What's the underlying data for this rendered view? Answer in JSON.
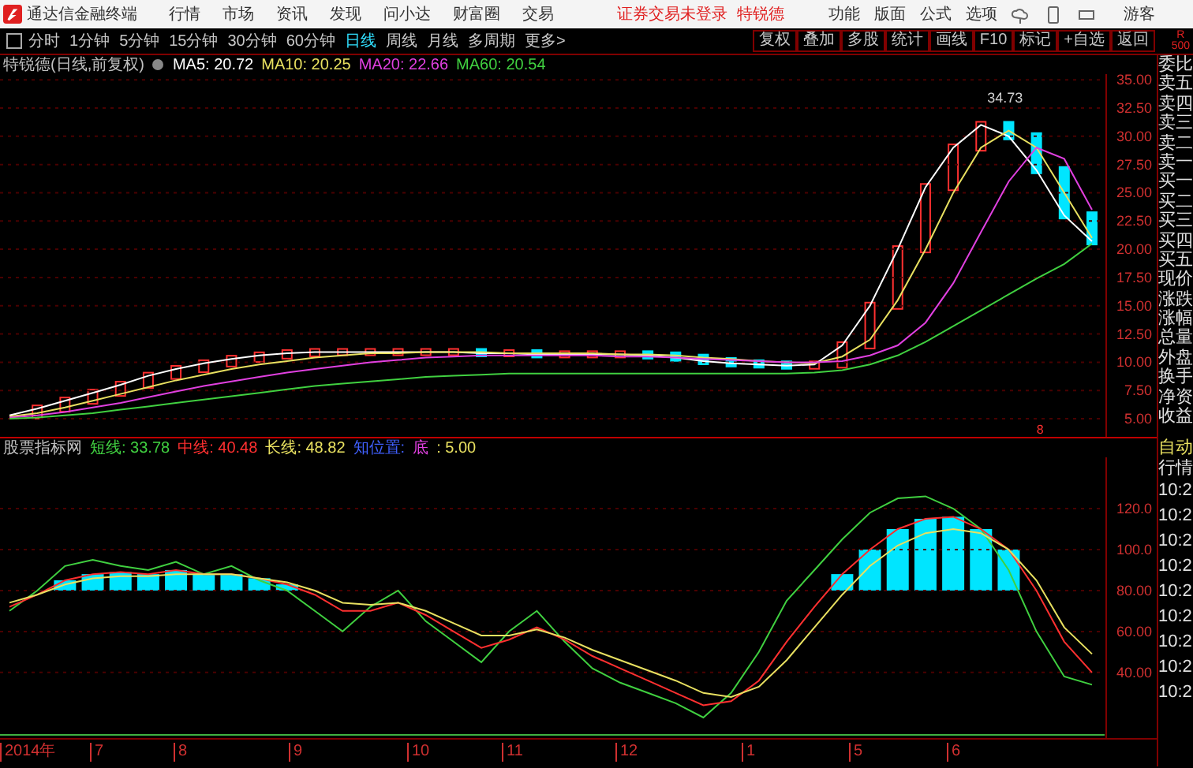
{
  "title_bar": {
    "app_name": "通达信金融终端",
    "menu": [
      "行情",
      "市场",
      "资讯",
      "发现",
      "问小达",
      "财富圈",
      "交易"
    ],
    "login_notice": "证券交易未登录",
    "stock_name": "特锐德",
    "tools": [
      "功能",
      "版面",
      "公式",
      "选项"
    ],
    "user": "游客"
  },
  "toolbar": {
    "periods": [
      {
        "label": "分时",
        "selected": false
      },
      {
        "label": "1分钟",
        "selected": false
      },
      {
        "label": "5分钟",
        "selected": false
      },
      {
        "label": "15分钟",
        "selected": false
      },
      {
        "label": "30分钟",
        "selected": false
      },
      {
        "label": "60分钟",
        "selected": false
      },
      {
        "label": "日线",
        "selected": true
      },
      {
        "label": "周线",
        "selected": false
      },
      {
        "label": "月线",
        "selected": false
      },
      {
        "label": "多周期",
        "selected": false
      },
      {
        "label": "更多>",
        "selected": false
      }
    ],
    "actions": [
      "复权",
      "叠加",
      "多股",
      "统计",
      "画线",
      "F10",
      "标记",
      "+自选",
      "返回"
    ],
    "corner": [
      "R",
      "500"
    ]
  },
  "main_chart": {
    "title": "特锐德(日线,前复权)",
    "legend_values": [
      ": 20.72",
      ": 20.25",
      ": 22.66",
      ": 20.54"
    ],
    "chart_data": {
      "type": "line",
      "grid": true,
      "ylim": [
        3.4,
        35.5
      ],
      "yticks": [
        {
          "value": 5,
          "label": "5.00"
        },
        {
          "value": 7.5,
          "label": "7.50"
        },
        {
          "value": 10,
          "label": "10.00"
        },
        {
          "value": 12.5,
          "label": "12.50"
        },
        {
          "value": 15,
          "label": "15.00"
        },
        {
          "value": 17.5,
          "label": "17.50"
        },
        {
          "value": 20,
          "label": "20.00"
        },
        {
          "value": 22.5,
          "label": "22.50"
        },
        {
          "value": 25,
          "label": "25.00"
        },
        {
          "value": 27.5,
          "label": "27.50"
        },
        {
          "value": 30,
          "label": "30.00"
        },
        {
          "value": 32.5,
          "label": "32.50"
        },
        {
          "value": 35,
          "label": "35.00"
        }
      ],
      "series": [
        {
          "name": "MA5",
          "color": "#ffffff",
          "values": [
            5.3,
            5.9,
            6.6,
            7.3,
            8.0,
            8.8,
            9.4,
            9.9,
            10.3,
            10.6,
            10.8,
            10.9,
            10.9,
            10.9,
            10.9,
            10.9,
            10.9,
            10.8,
            10.8,
            10.7,
            10.7,
            10.7,
            10.7,
            10.6,
            10.4,
            10.1,
            9.9,
            9.8,
            9.7,
            9.8,
            11.5,
            15,
            20,
            25.5,
            29,
            31,
            30,
            27,
            23,
            20.7
          ]
        },
        {
          "name": "MA10",
          "color": "#e8e060",
          "values": [
            5.2,
            5.5,
            6.0,
            6.6,
            7.2,
            7.8,
            8.4,
            8.9,
            9.4,
            9.8,
            10.1,
            10.4,
            10.6,
            10.8,
            10.8,
            10.9,
            10.9,
            10.9,
            10.8,
            10.8,
            10.8,
            10.8,
            10.7,
            10.7,
            10.6,
            10.4,
            10.3,
            10.1,
            10.0,
            9.9,
            10.5,
            12,
            15.5,
            20,
            25,
            29,
            30.5,
            29,
            25,
            21
          ]
        },
        {
          "name": "MA20",
          "color": "#e040e0",
          "values": [
            5.1,
            5.3,
            5.6,
            6.0,
            6.4,
            6.9,
            7.4,
            7.9,
            8.3,
            8.7,
            9.1,
            9.4,
            9.7,
            10.0,
            10.2,
            10.4,
            10.5,
            10.6,
            10.6,
            10.6,
            10.6,
            10.6,
            10.5,
            10.5,
            10.4,
            10.3,
            10.2,
            10.1,
            10.0,
            10.0,
            10.1,
            10.6,
            11.5,
            13.5,
            17,
            21.5,
            26,
            29,
            28,
            23.5
          ]
        },
        {
          "name": "MA60",
          "color": "#40d040",
          "values": [
            5.0,
            5.1,
            5.3,
            5.5,
            5.8,
            6.1,
            6.4,
            6.7,
            7.0,
            7.3,
            7.6,
            7.9,
            8.1,
            8.3,
            8.5,
            8.7,
            8.8,
            8.9,
            9.0,
            9.0,
            9.0,
            9.0,
            9.0,
            9.0,
            9.0,
            9.0,
            9.0,
            9.0,
            9.0,
            9.1,
            9.3,
            9.8,
            10.6,
            11.8,
            13.2,
            14.6,
            16,
            17.4,
            18.7,
            20.5
          ]
        }
      ],
      "annotations": [
        "34.73",
        "8"
      ]
    }
  },
  "indicator": {
    "title": "股票指标网",
    "legend_values": [
      ": 33.78",
      ": 40.48",
      ": 48.82"
    ],
    "extras": [
      {
        "label": "知位置:",
        "color": "#4060ff"
      },
      {
        "label": "底",
        "color": "#e040e0"
      },
      {
        "label": ": 5.00",
        "color": "#e8e060"
      }
    ],
    "chart_data": {
      "type": "line",
      "grid": true,
      "ylim": [
        8,
        145
      ],
      "yticks": [
        {
          "value": 40,
          "label": "40.00"
        },
        {
          "value": 60,
          "label": "60.00"
        },
        {
          "value": 80,
          "label": "80.00"
        },
        {
          "value": 100,
          "label": "100.0"
        },
        {
          "value": 120,
          "label": "120.0"
        }
      ],
      "series": [
        {
          "name": "短线",
          "color": "#40d040",
          "values": [
            70,
            80,
            92,
            95,
            92,
            90,
            94,
            88,
            92,
            85,
            80,
            70,
            60,
            72,
            80,
            65,
            55,
            45,
            60,
            70,
            55,
            42,
            35,
            30,
            25,
            18,
            30,
            50,
            75,
            90,
            105,
            118,
            125,
            126,
            120,
            110,
            90,
            60,
            38,
            34
          ]
        },
        {
          "name": "中线",
          "color": "#ff3030",
          "values": [
            72,
            78,
            85,
            88,
            89,
            88,
            90,
            88,
            88,
            86,
            83,
            78,
            70,
            70,
            74,
            68,
            60,
            52,
            56,
            62,
            56,
            48,
            42,
            36,
            30,
            24,
            26,
            36,
            55,
            72,
            88,
            100,
            110,
            115,
            116,
            110,
            100,
            80,
            55,
            40
          ]
        },
        {
          "name": "长线",
          "color": "#e8e060",
          "values": [
            74,
            78,
            83,
            86,
            87,
            87,
            88,
            88,
            88,
            86,
            84,
            80,
            74,
            73,
            74,
            70,
            64,
            58,
            58,
            61,
            57,
            51,
            46,
            41,
            36,
            30,
            28,
            33,
            46,
            62,
            78,
            92,
            102,
            108,
            110,
            108,
            100,
            85,
            62,
            49
          ]
        }
      ]
    }
  },
  "x_axis": {
    "labels": [
      "2014年",
      "7",
      "8",
      "9",
      "10",
      "11",
      "12",
      "1",
      "5",
      "6"
    ]
  },
  "quote_panel": {
    "labels": [
      "委比",
      "卖五",
      "卖四",
      "卖三",
      "卖二",
      "卖一",
      "买一",
      "买二",
      "买三",
      "买四",
      "买五",
      "现价",
      "涨跌",
      "涨幅",
      "总量",
      "外盘",
      "换手",
      "净资",
      "收益"
    ]
  },
  "tick_panel": {
    "header": "自动",
    "title": "行情",
    "times": [
      "10:2",
      "10:2",
      "10:2",
      "10:2",
      "10:2",
      "10:2",
      "10:2",
      "10:2",
      "10:2"
    ]
  }
}
